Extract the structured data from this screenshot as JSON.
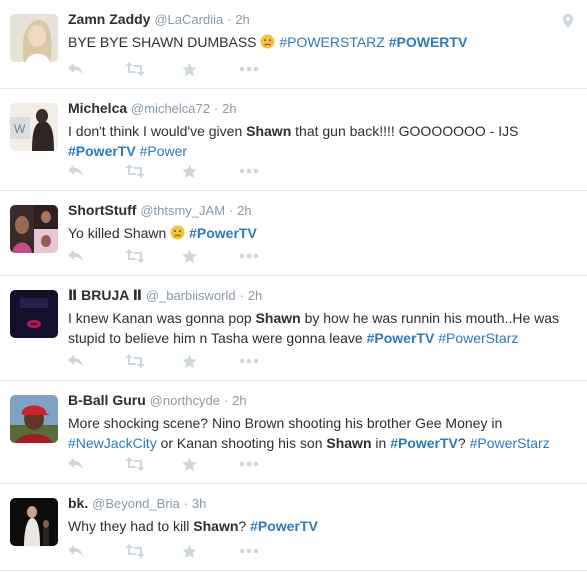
{
  "tweets": [
    {
      "fullname": "Zamn Zaddy",
      "username": "@LaCardiia",
      "separator": "·",
      "time": "2h",
      "avatar_icon": "woman-portrait-avatar",
      "has_geo": true,
      "segments": [
        {
          "t": "BYE BYE SHAWN DUMBASS "
        },
        {
          "t": "crying-face",
          "emoji": true
        },
        {
          "t": " "
        },
        {
          "t": "#POWERSTARZ",
          "hash": true
        },
        {
          "t": " "
        },
        {
          "t": "#POWERTV",
          "hash": true,
          "bold": true
        }
      ]
    },
    {
      "fullname": "Michelca",
      "username": "@michelca72",
      "separator": "·",
      "time": "2h",
      "avatar_icon": "person-silhouette-avatar",
      "has_geo": false,
      "segments": [
        {
          "t": "I don't think I would've given "
        },
        {
          "t": "Shawn",
          "bold": true
        },
        {
          "t": " that gun back!!!! GOOOOOOO - IJS "
        },
        {
          "t": "#PowerTV",
          "hash": true,
          "bold": true
        },
        {
          "t": " "
        },
        {
          "t": "#Power",
          "hash": true
        }
      ]
    },
    {
      "fullname": "ShortStuff",
      "username": "@thtsmy_JAM",
      "separator": "·",
      "time": "2h",
      "avatar_icon": "woman-collage-avatar",
      "has_geo": false,
      "segments": [
        {
          "t": "Yo killed Shawn "
        },
        {
          "t": "crying-face",
          "emoji": true
        },
        {
          "t": " "
        },
        {
          "t": "#PowerTV",
          "hash": true,
          "bold": true
        }
      ]
    },
    {
      "fullname": "Ⅱ BRUJA Ⅱ",
      "username": "@_barbiisworld",
      "separator": "·",
      "time": "2h",
      "avatar_icon": "dark-graphic-avatar",
      "has_geo": false,
      "segments": [
        {
          "t": "I knew Kanan was gonna pop "
        },
        {
          "t": "Shawn",
          "bold": true
        },
        {
          "t": " by how he was runnin his mouth..He was stupid to believe him n Tasha were gonna leave "
        },
        {
          "t": "#PowerTV",
          "hash": true,
          "bold": true
        },
        {
          "t": " "
        },
        {
          "t": "#PowerStarz",
          "hash": true
        }
      ]
    },
    {
      "fullname": "B-Ball Guru",
      "username": "@northcyde",
      "separator": "·",
      "time": "2h",
      "avatar_icon": "man-red-cap-avatar",
      "has_geo": false,
      "segments": [
        {
          "t": "More shocking scene?  Nino Brown shooting his brother Gee Money in "
        },
        {
          "t": "#NewJackCity",
          "hash": true
        },
        {
          "t": " or Kanan shooting his son "
        },
        {
          "t": "Shawn",
          "bold": true
        },
        {
          "t": " in "
        },
        {
          "t": "#PowerTV",
          "hash": true,
          "bold": true
        },
        {
          "t": "? "
        },
        {
          "t": "#PowerStarz",
          "hash": true
        }
      ]
    },
    {
      "fullname": "bk.",
      "username": "@Beyond_Bria",
      "separator": "·",
      "time": "3h",
      "avatar_icon": "dark-stage-avatar",
      "has_geo": false,
      "segments": [
        {
          "t": "Why they had to kill "
        },
        {
          "t": "Shawn",
          "bold": true
        },
        {
          "t": "? "
        },
        {
          "t": "#PowerTV",
          "hash": true,
          "bold": true
        }
      ]
    }
  ],
  "actions": [
    "reply-icon",
    "retweet-icon",
    "favorite-icon",
    "more-icon"
  ],
  "colors": {
    "link": "#2b7bb9",
    "muted": "#8899a6",
    "action_icon": "#ccd6dd",
    "border": "#e1e8ed",
    "text": "#292f33"
  }
}
